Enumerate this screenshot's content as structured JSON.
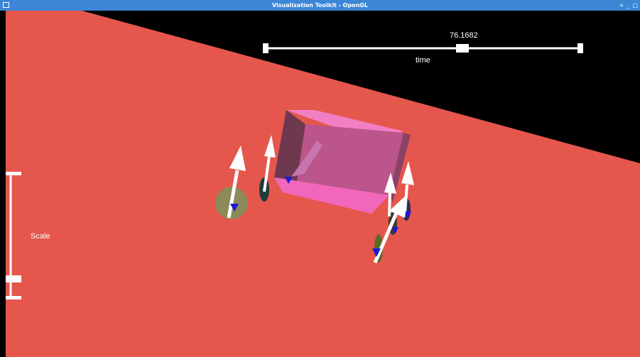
{
  "window": {
    "title": "Visualization Toolkit - OpenGL",
    "controls": [
      "+",
      "_",
      "□"
    ]
  },
  "time_slider": {
    "value": "76.1682",
    "label": "time",
    "position_fraction": 0.62
  },
  "scale_slider": {
    "label": "Scale",
    "position_fraction": 0.85
  },
  "colors": {
    "ground": "#e5564d",
    "background": "#000000",
    "box": "#f06cd0",
    "arrow": "#ffffff",
    "arrow_tip": "#1a1ad6",
    "titlebar": "#3d86d6",
    "wheel_highlight": "#8b8a58"
  }
}
